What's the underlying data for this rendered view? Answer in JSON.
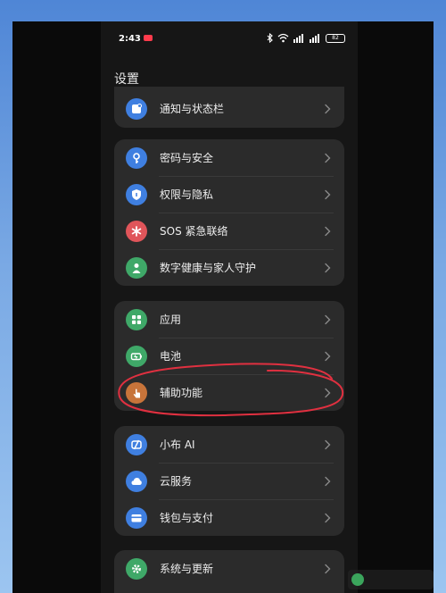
{
  "status_bar": {
    "time": "2:43",
    "battery": "82"
  },
  "page": {
    "title": "设置"
  },
  "groups": [
    {
      "items": [
        {
          "label": "通知与状态栏",
          "icon": "notification-icon",
          "color": "#3f7fe0"
        }
      ]
    },
    {
      "items": [
        {
          "label": "密码与安全",
          "icon": "key-icon",
          "color": "#3f7fe0"
        },
        {
          "label": "权限与隐私",
          "icon": "shield-icon",
          "color": "#3f7fe0"
        },
        {
          "label": "SOS 紧急联络",
          "icon": "asterisk-icon",
          "color": "#e0555a"
        },
        {
          "label": "数字健康与家人守护",
          "icon": "person-leaf-icon",
          "color": "#3fa868"
        }
      ]
    },
    {
      "items": [
        {
          "label": "应用",
          "icon": "apps-grid-icon",
          "color": "#3fa868"
        },
        {
          "label": "电池",
          "icon": "battery-icon",
          "color": "#3fa868"
        },
        {
          "label": "辅助功能",
          "icon": "hand-touch-icon",
          "color": "#c8743a"
        }
      ]
    },
    {
      "items": [
        {
          "label": "小布 AI",
          "icon": "ai-assistant-icon",
          "color": "#3f7fe0"
        },
        {
          "label": "云服务",
          "icon": "cloud-icon",
          "color": "#3f7fe0"
        },
        {
          "label": "钱包与支付",
          "icon": "wallet-icon",
          "color": "#3f7fe0"
        }
      ]
    },
    {
      "items": [
        {
          "label": "系统与更新",
          "icon": "gear-icon",
          "color": "#3fa868"
        }
      ]
    }
  ],
  "annotation_color": "#e03040"
}
